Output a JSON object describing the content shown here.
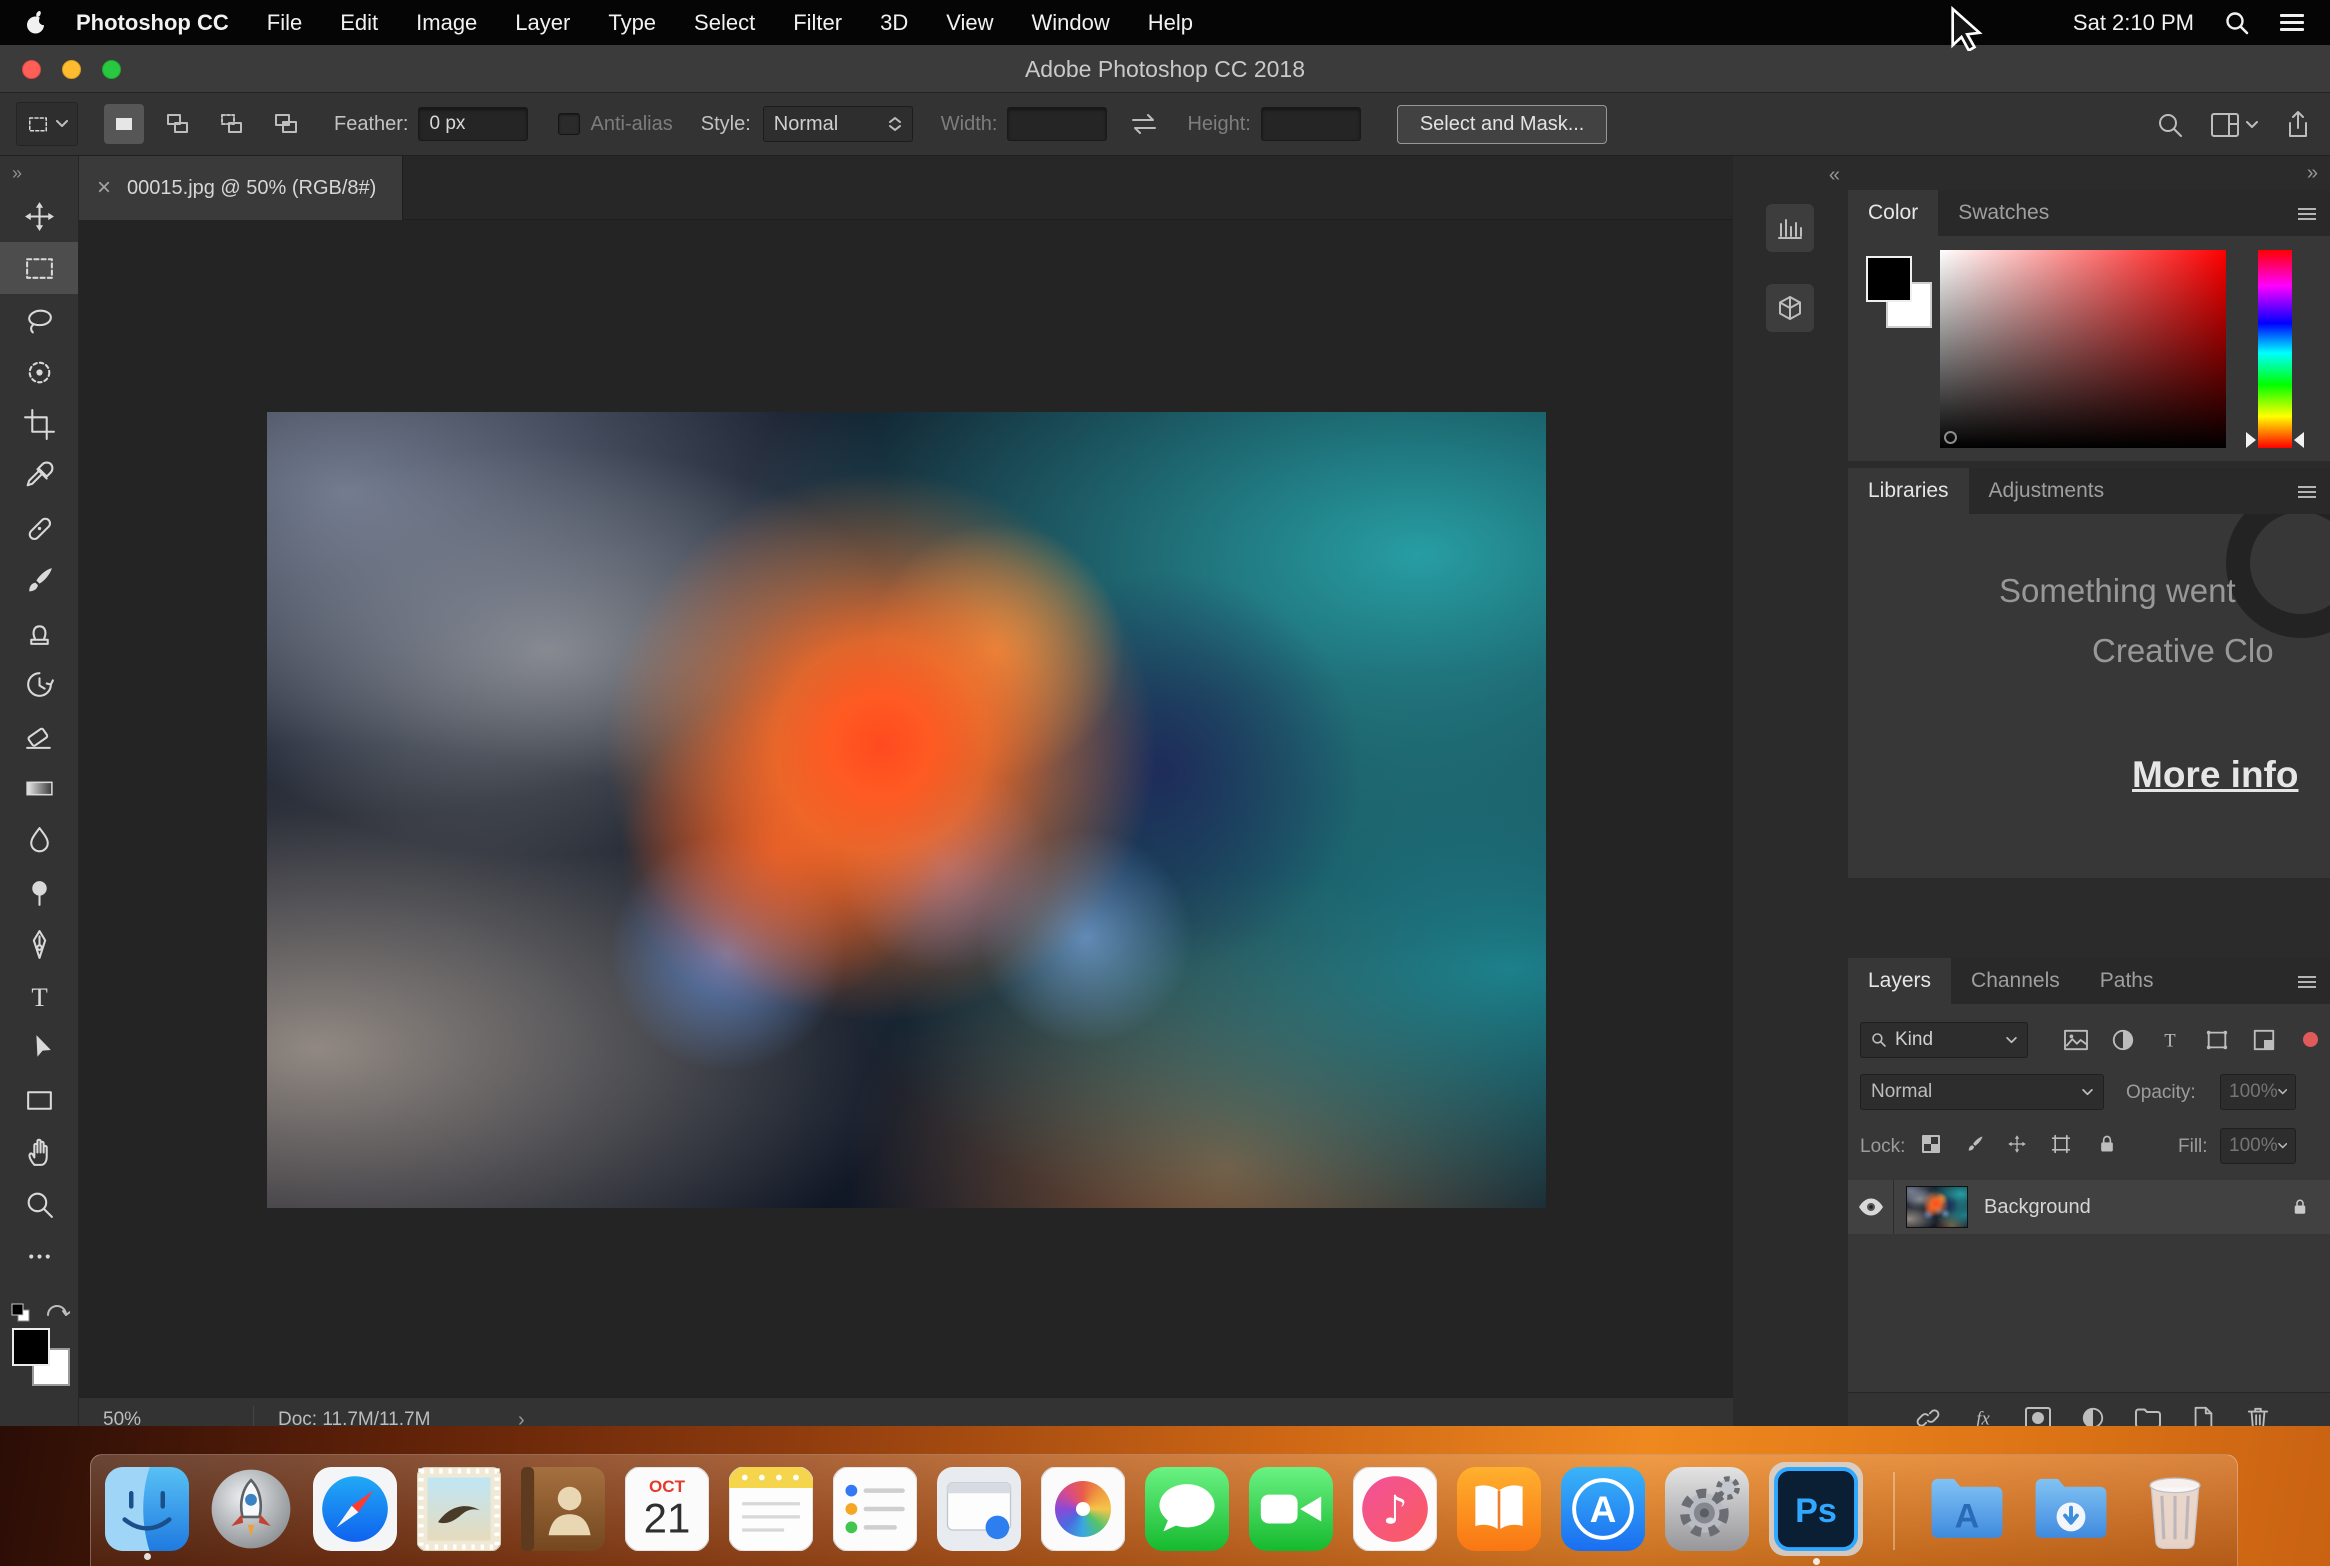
{
  "menubar": {
    "apple_icon": "apple-logo",
    "app_name": "Photoshop CC",
    "menus": [
      "File",
      "Edit",
      "Image",
      "Layer",
      "Type",
      "Select",
      "Filter",
      "3D",
      "View",
      "Window",
      "Help"
    ],
    "clock": "Sat 2:10 PM"
  },
  "titlebar": {
    "title": "Adobe Photoshop CC 2018"
  },
  "options_bar": {
    "feather_label": "Feather:",
    "feather_value": "0 px",
    "antialias_label": "Anti-alias",
    "style_label": "Style:",
    "style_value": "Normal",
    "width_label": "Width:",
    "width_value": "",
    "height_label": "Height:",
    "height_value": "",
    "select_mask_button": "Select and Mask..."
  },
  "toolbar": {
    "tools": [
      "move",
      "rectangular-marquee",
      "lasso",
      "quick-selection",
      "crop",
      "eyedropper",
      "spot-healing-brush",
      "brush",
      "clone-stamp",
      "history-brush",
      "eraser",
      "gradient",
      "blur",
      "dodge",
      "pen",
      "type",
      "path-selection",
      "rectangle",
      "hand",
      "zoom",
      "edit-toolbar"
    ],
    "selected_tool": "rectangular-marquee"
  },
  "document": {
    "close_glyph": "×",
    "tab_title": "00015.jpg @ 50% (RGB/8#)",
    "zoom_level": "50%",
    "doc_info": "Doc: 11.7M/11.7M"
  },
  "panels": {
    "color": {
      "tabs": [
        "Color",
        "Swatches"
      ],
      "active_tab": "Color"
    },
    "libraries": {
      "tabs": [
        "Libraries",
        "Adjustments"
      ],
      "active_tab": "Libraries",
      "message_line1": "Something went",
      "message_line2": "Creative Clo",
      "more_info_link": "More info"
    },
    "layers": {
      "tabs": [
        "Layers",
        "Channels",
        "Paths"
      ],
      "active_tab": "Layers",
      "filter_kind": "Kind",
      "blend_mode": "Normal",
      "opacity_label": "Opacity:",
      "opacity_value": "100%",
      "lock_label": "Lock:",
      "fill_label": "Fill:",
      "fill_value": "100%",
      "rows": [
        {
          "name": "Background",
          "visible": true,
          "locked": true
        }
      ]
    }
  },
  "icons": {
    "search": "magnifier",
    "notification_center": "hamburger-lines",
    "panel_collapse_left": "«",
    "panel_collapse_right": "»",
    "status_history_chevron": "›",
    "collapsed_panels": [
      "histogram",
      "3d-cube"
    ]
  },
  "dock": {
    "items": [
      "finder",
      "launchpad",
      "safari",
      "mail",
      "contacts",
      "calendar",
      "notes",
      "reminders",
      "app-window",
      "photos",
      "messages",
      "facetime",
      "itunes",
      "books",
      "app-store",
      "system-preferences",
      "photoshop",
      "applications-folder",
      "downloads-folder",
      "trash"
    ],
    "calendar_month": "OCT",
    "calendar_day": "21",
    "itunes_glyph": "♪",
    "app_store_glyph": "A",
    "applications_folder_glyph": "A",
    "photoshop_glyph": "Ps"
  }
}
